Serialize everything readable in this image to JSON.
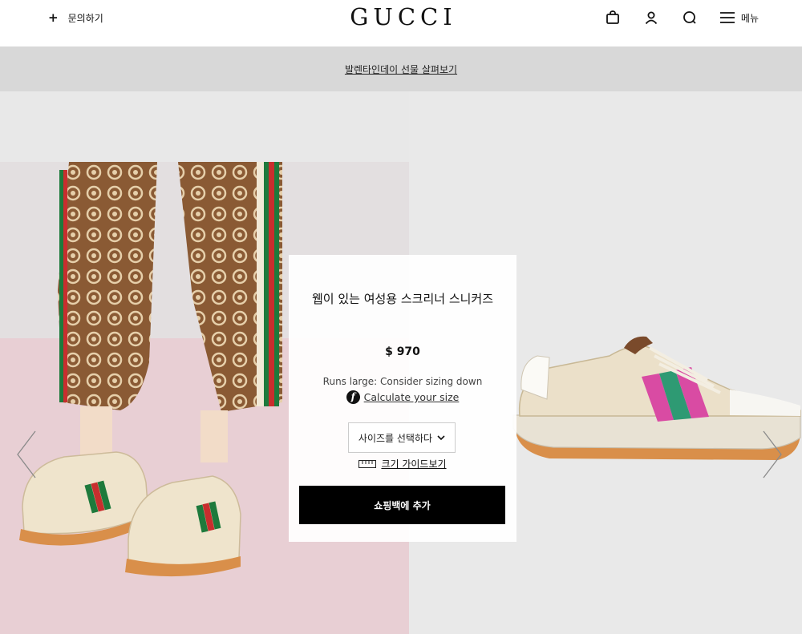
{
  "header": {
    "contact_label": "문의하기",
    "logo": "GUCCI",
    "menu_label": "메뉴"
  },
  "promo": {
    "link_text": "발렌타인데이 선물 살펴보기"
  },
  "product": {
    "title": "웹이 있는 여성용 스크리너 스니커즈",
    "price": "$ 970",
    "fit_note": "Runs large: Consider sizing down",
    "calculate_link": "Calculate your size",
    "size_select_placeholder": "사이즈를 선택하다",
    "size_guide_link": "크기 가이드보기",
    "add_to_bag": "쇼핑백에 추가"
  },
  "icons": {
    "contact": "plus-icon",
    "bag": "shopping-bag-icon",
    "account": "user-icon",
    "search": "search-icon",
    "menu": "hamburger-icon",
    "prev": "chevron-left-icon",
    "next": "chevron-right-icon",
    "size_select": "chevron-down-icon",
    "size_guide": "ruler-icon",
    "calculator": "fit-finder-icon"
  },
  "colors": {
    "button_bg": "#000000",
    "promo_bg": "#d8d8d8",
    "page_bg": "#e8e8e8",
    "left_photo_bg": "#eedfe1"
  }
}
